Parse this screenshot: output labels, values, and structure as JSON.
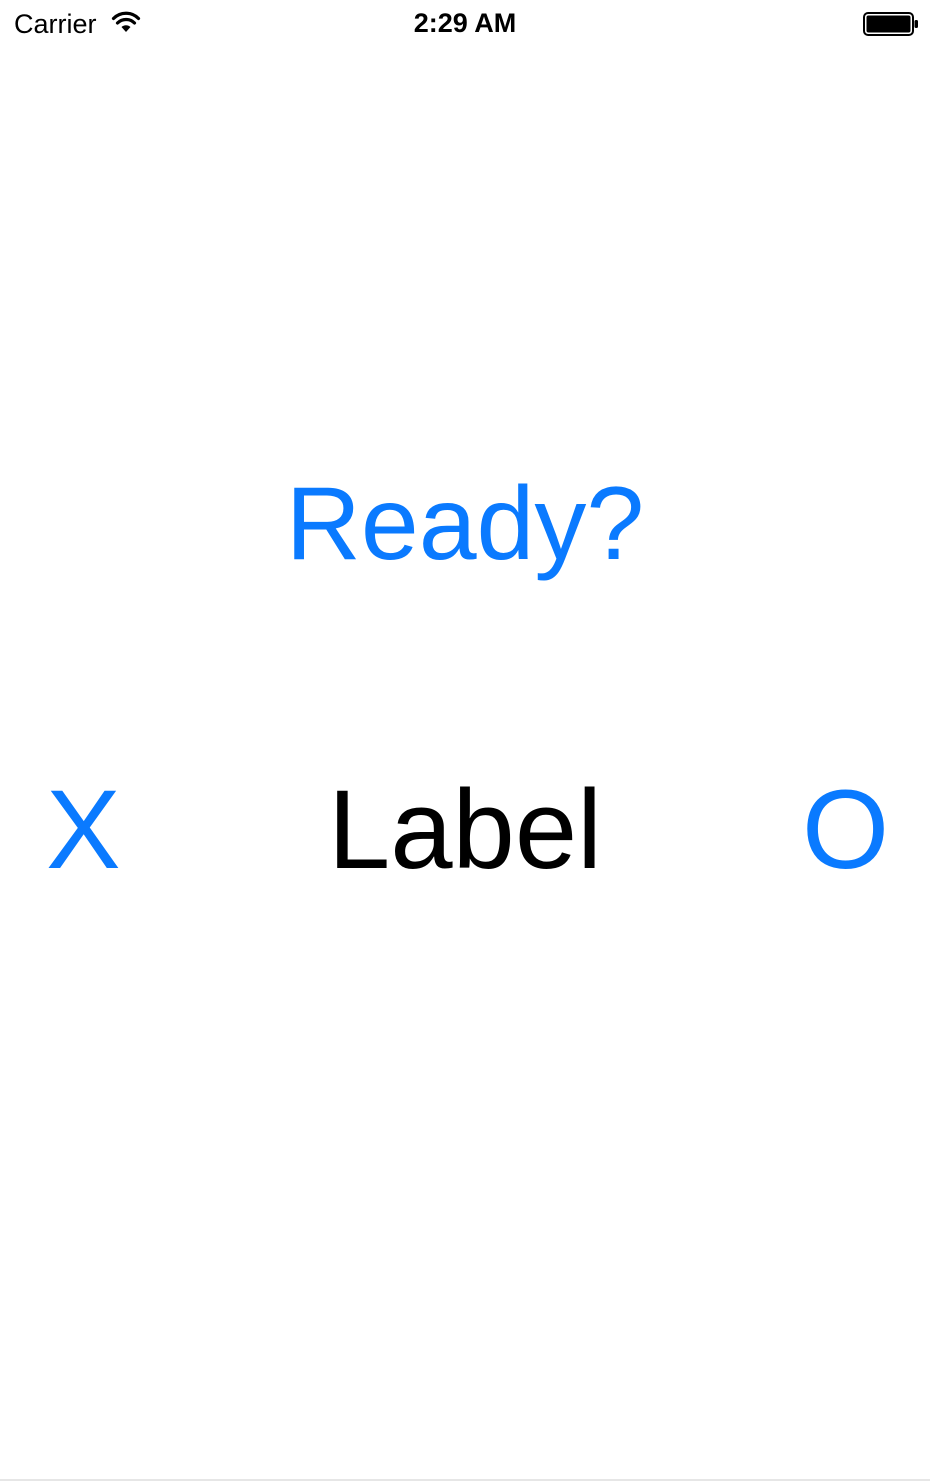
{
  "status_bar": {
    "carrier": "Carrier",
    "time": "2:29 AM",
    "wifi_icon": "wifi-icon",
    "battery_icon": "battery-icon"
  },
  "main": {
    "ready_label": "Ready?",
    "center_label": "Label",
    "x_label": "X",
    "o_label": "O"
  },
  "colors": {
    "accent": "#0a7aff",
    "text": "#000000",
    "background": "#ffffff"
  }
}
